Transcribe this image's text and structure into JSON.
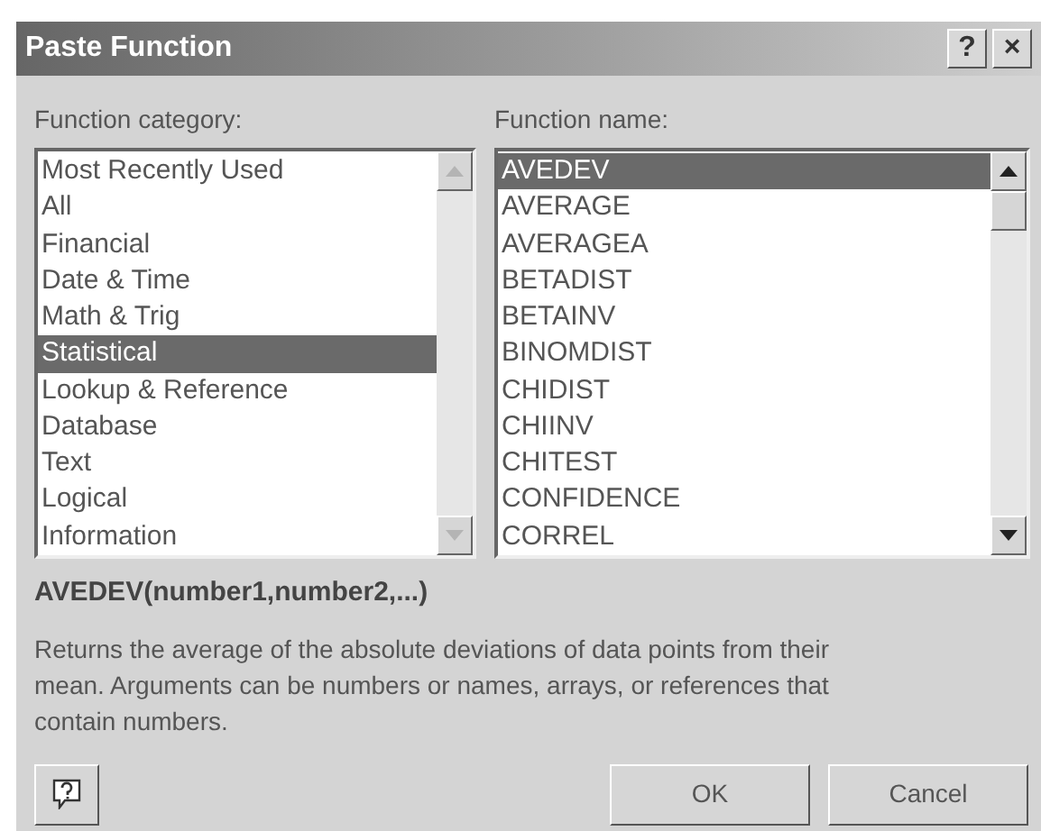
{
  "window": {
    "title": "Paste Function",
    "title_buttons": [
      "?",
      "×"
    ]
  },
  "lists": [
    {
      "label": "Function category:",
      "scroll_disabled": true,
      "items": [
        {
          "text": "Most Recently Used",
          "selected": false
        },
        {
          "text": "All",
          "selected": false
        },
        {
          "text": "Financial",
          "selected": false
        },
        {
          "text": "Date & Time",
          "selected": false
        },
        {
          "text": "Math & Trig",
          "selected": false
        },
        {
          "text": "Statistical",
          "selected": true
        },
        {
          "text": "Lookup & Reference",
          "selected": false
        },
        {
          "text": "Database",
          "selected": false
        },
        {
          "text": "Text",
          "selected": false
        },
        {
          "text": "Logical",
          "selected": false
        },
        {
          "text": "Information",
          "selected": false
        }
      ]
    },
    {
      "label": "Function name:",
      "scroll_disabled": false,
      "items": [
        {
          "text": "AVEDEV",
          "selected": true
        },
        {
          "text": "AVERAGE",
          "selected": false
        },
        {
          "text": "AVERAGEA",
          "selected": false
        },
        {
          "text": "BETADIST",
          "selected": false
        },
        {
          "text": "BETAINV",
          "selected": false
        },
        {
          "text": "BINOMDIST",
          "selected": false
        },
        {
          "text": "CHIDIST",
          "selected": false
        },
        {
          "text": "CHIINV",
          "selected": false
        },
        {
          "text": "CHITEST",
          "selected": false
        },
        {
          "text": "CONFIDENCE",
          "selected": false
        },
        {
          "text": "CORREL",
          "selected": false
        }
      ]
    }
  ],
  "signature": "AVEDEV(number1,number2,...)",
  "description": "Returns the average of the absolute deviations of data points from their mean. Arguments can be numbers or names, arrays, or references that contain numbers.",
  "buttons": [
    {
      "label": "OK"
    },
    {
      "label": "Cancel"
    }
  ]
}
